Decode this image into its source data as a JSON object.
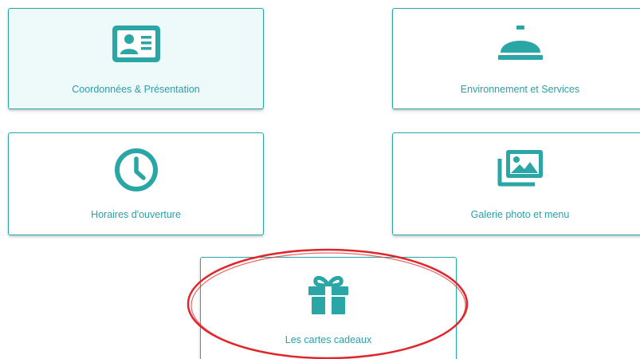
{
  "cards": [
    {
      "label": "Coordonnées & Présentation",
      "icon": "contact-card-icon",
      "active": true
    },
    {
      "label": "Environnement et Services",
      "icon": "service-bell-icon",
      "active": false
    },
    {
      "label": "Horaires d'ouverture",
      "icon": "clock-icon",
      "active": false
    },
    {
      "label": "Galerie photo et menu",
      "icon": "photo-gallery-icon",
      "active": false
    },
    {
      "label": "Les cartes cadeaux",
      "icon": "gift-icon",
      "active": false
    }
  ],
  "colors": {
    "accent": "#2aa6a6",
    "text": "#2a9fa6",
    "active_background": "#eef9fa",
    "annotation": "#e0262b"
  },
  "annotation": {
    "type": "ellipse",
    "target": "Les cartes cadeaux",
    "color": "#e0262b"
  }
}
